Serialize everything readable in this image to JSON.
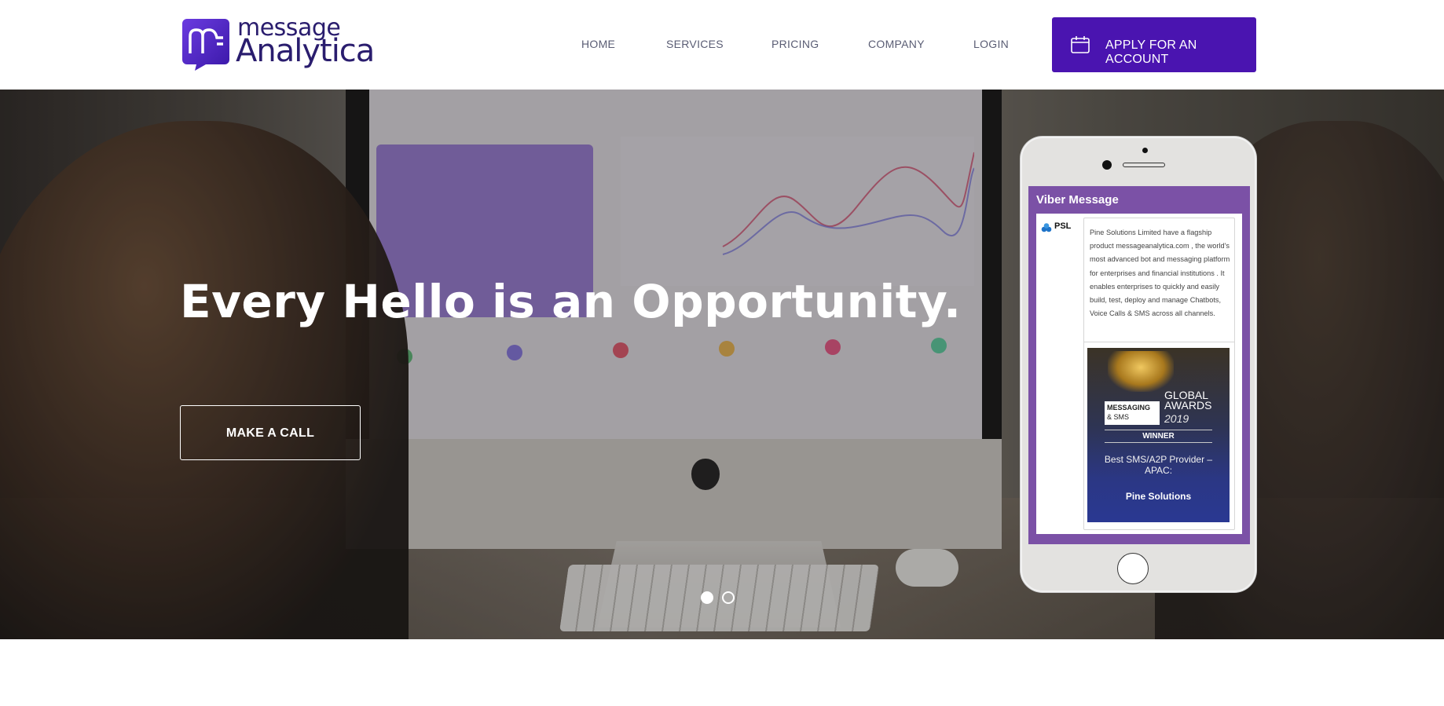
{
  "brand": {
    "logo_top": "message",
    "logo_bottom": "Analytica",
    "accent_color": "#4a14b0"
  },
  "nav": {
    "items": [
      {
        "label": "HOME"
      },
      {
        "label": "SERVICES"
      },
      {
        "label": "PRICING"
      },
      {
        "label": "COMPANY"
      },
      {
        "label": "LOGIN"
      }
    ],
    "cta_label": "APPLY FOR AN ACCOUNT",
    "cta_icon": "calendar-icon"
  },
  "hero": {
    "title": "Every Hello is an Opportunity.",
    "button_label": "MAKE A CALL",
    "carousel_slides": 2,
    "carousel_active": 1
  },
  "phone": {
    "app_title": "Viber Message",
    "sender": "PSL",
    "message": "Pine Solutions Limited have a flagship product messageanalytica.com , the world's most advanced bot and  messaging platform for enterprises and financial institutions . It enables enterprises to quickly and easily build, test, deploy and manage Chatbots, Voice Calls & SMS across all channels.",
    "award": {
      "tag_line1": "MESSAGING",
      "tag_line2": "& SMS",
      "global_awards": "GLOBAL AWARDS",
      "year": "2019",
      "winner": "WINNER",
      "category": "Best SMS/A2P Provider – APAC:",
      "name": "Pine Solutions"
    }
  }
}
